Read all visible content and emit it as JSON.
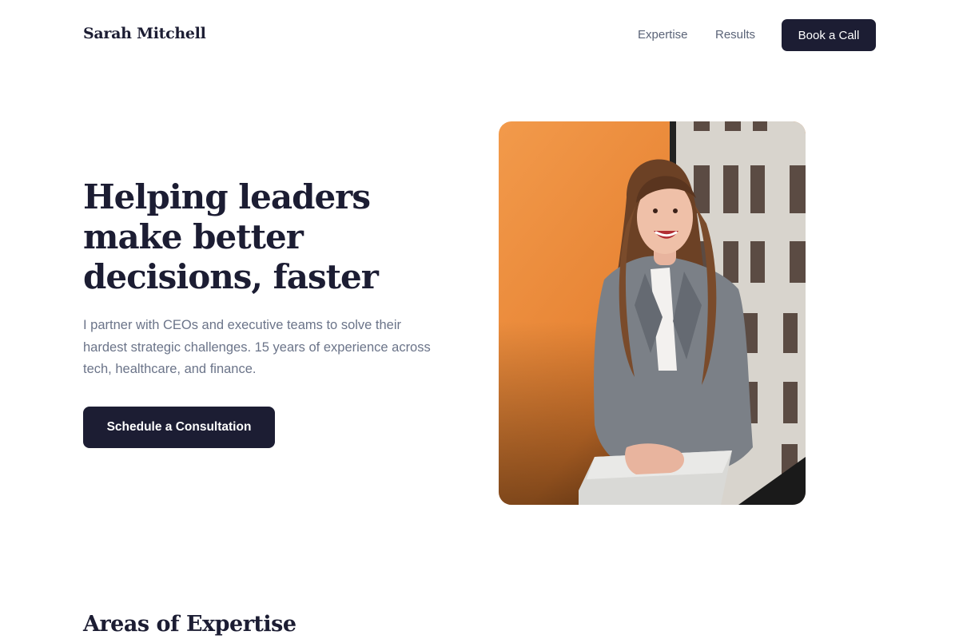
{
  "nav": {
    "brand": "Sarah Mitchell",
    "links": [
      "Expertise",
      "Results"
    ],
    "cta_label": "Book a Call"
  },
  "hero": {
    "title": "Helping leaders make better decisions, faster",
    "description": "I partner with CEOs and executive teams to solve their hardest strategic challenges. 15 years of experience across tech, healthcare, and finance.",
    "cta_label": "Schedule a Consultation",
    "image": "portrait-photo"
  },
  "section": {
    "title": "Areas of Expertise"
  },
  "colors": {
    "primary": "#1c1d33",
    "muted_text": "#6b7489",
    "nav_link": "#5b6478",
    "photo_wall": "#f0913c"
  }
}
